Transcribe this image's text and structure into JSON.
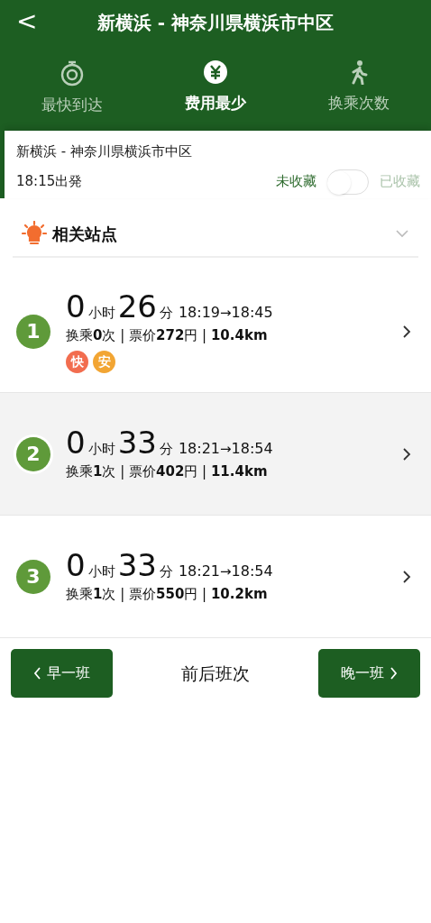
{
  "header": {
    "back": "<",
    "title": "新横浜 - 神奈川県横浜市中区"
  },
  "tabs": [
    {
      "kind": "stopwatch",
      "label": "最快到达",
      "selected": false
    },
    {
      "kind": "yen",
      "label": "费用最少",
      "selected": true
    },
    {
      "kind": "walker",
      "label": "换乘次数",
      "selected": false
    }
  ],
  "trip": {
    "route": "新横浜 - 神奈川県横浜市中区",
    "departure": "18:15出発",
    "off_label": "未收藏",
    "on_label": "已收藏",
    "favorited": false
  },
  "related": {
    "title": "相关站点",
    "expanded": false
  },
  "routes": [
    {
      "number": "1",
      "hours": "0",
      "hours_unit": "小时",
      "minutes": "26",
      "minutes_unit": "分",
      "depart": "18:19",
      "arrow": "→",
      "arrive": "18:45",
      "details": "换乘**0**次 | 票价**272**円 | **10.4km**",
      "badges": [
        {
          "text": "快",
          "color": "#f26d4f"
        },
        {
          "text": "安",
          "color": "#f2a533"
        }
      ],
      "selected": false
    },
    {
      "number": "2",
      "hours": "0",
      "hours_unit": "小时",
      "minutes": "33",
      "minutes_unit": "分",
      "depart": "18:21",
      "arrow": "→",
      "arrive": "18:54",
      "details": "换乘**1**次 | 票价**402**円 | **11.4km**",
      "selected": true
    },
    {
      "number": "3",
      "hours": "0",
      "hours_unit": "小时",
      "minutes": "33",
      "minutes_unit": "分",
      "depart": "18:21",
      "arrow": "→",
      "arrive": "18:54",
      "details": "换乘**1**次 | 票价**550**円 | **10.2km**",
      "selected": false
    }
  ],
  "footer": {
    "earlier": "早一班",
    "center": "前后班次",
    "later": "晚一班"
  }
}
